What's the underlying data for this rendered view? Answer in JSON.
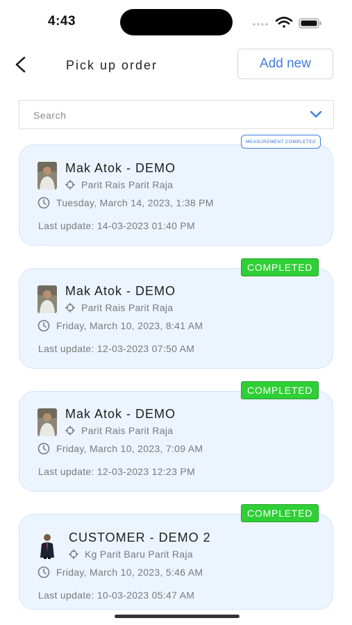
{
  "status_bar": {
    "time": "4:43"
  },
  "header": {
    "title": "Pick up order",
    "add_label": "Add new"
  },
  "search": {
    "placeholder": "Search"
  },
  "orders": [
    {
      "status": "MEASUREMENT COMPLETED",
      "name": "Mak Atok - DEMO",
      "address": "Parit Rais Parit Raja",
      "datetime": "Tuesday, March 14, 2023, 1:38 PM",
      "last_update": "Last update: 14-03-2023 01:40 PM"
    },
    {
      "status": "COMPLETED",
      "name": "Mak Atok - DEMO",
      "address": "Parit Rais Parit Raja",
      "datetime": "Friday, March 10, 2023, 8:41 AM",
      "last_update": "Last update: 12-03-2023 07:50 AM"
    },
    {
      "status": "COMPLETED",
      "name": "Mak Atok - DEMO",
      "address": "Parit Rais Parit Raja",
      "datetime": "Friday, March 10, 2023, 7:09 AM",
      "last_update": "Last update: 12-03-2023 12:23 PM"
    },
    {
      "status": "COMPLETED",
      "name": "CUSTOMER - DEMO 2",
      "address": "Kg Parit Baru Parit Raja",
      "datetime": "Friday, March 10, 2023, 5:46 AM",
      "last_update": "Last update: 10-03-2023 05:47 AM"
    }
  ],
  "colors": {
    "accent": "#3f7ce0",
    "badge_green": "#2fcf36",
    "card_bg": "#ecf4ff"
  },
  "icons": {
    "back": "chevron-left-icon",
    "dropdown": "chevron-down-icon",
    "location": "crosshair-icon",
    "time": "clock-icon"
  }
}
